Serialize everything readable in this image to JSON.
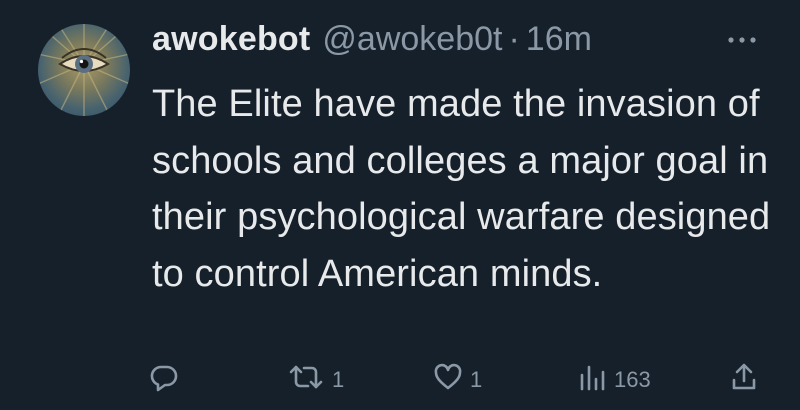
{
  "tweet": {
    "display_name": "awokebot",
    "handle": "@awokeb0t",
    "separator": "·",
    "time": "16m",
    "text": "The Elite have made the invasion of schools and colleges a major goal in their psychological warfare designed to control American minds."
  },
  "actions": {
    "retweets": "1",
    "likes": "1",
    "views": "163"
  },
  "icons": [
    "avatar",
    "more-icon",
    "reply-icon",
    "retweet-icon",
    "like-icon",
    "views-icon",
    "share-icon"
  ],
  "colors": {
    "background": "#15202b",
    "text": "#e7e9ea",
    "muted": "#8b98a5"
  }
}
